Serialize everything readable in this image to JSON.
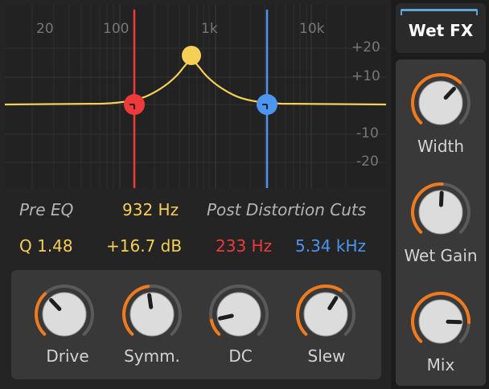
{
  "graph": {
    "freq_labels": [
      "20",
      "100",
      "1k",
      "10k"
    ],
    "db_labels": [
      "+20",
      "+10",
      "-10",
      "-20"
    ]
  },
  "pre_eq": {
    "label": "Pre EQ",
    "freq": "932 Hz",
    "q": "Q 1.48",
    "gain": "+16.7 dB"
  },
  "post": {
    "label": "Post Distortion Cuts",
    "low_cut": "233 Hz",
    "high_cut": "5.34 kHz"
  },
  "knobs": [
    {
      "label": "Drive",
      "value": 0.34
    },
    {
      "label": "Symm.",
      "value": 0.47
    },
    {
      "label": "DC",
      "value": 0.12
    },
    {
      "label": "Slew",
      "value": 0.62
    }
  ],
  "wet_fx": {
    "title": "Wet FX",
    "knobs": [
      {
        "label": "Width",
        "value": 0.66
      },
      {
        "label": "Wet Gain",
        "value": 0.51
      },
      {
        "label": "Mix",
        "value": 0.84
      }
    ]
  },
  "colors": {
    "accent": "#f07a1e",
    "peak": "#f6cf57",
    "low_cut": "#ef3a3c",
    "high_cut": "#4d95f0"
  }
}
